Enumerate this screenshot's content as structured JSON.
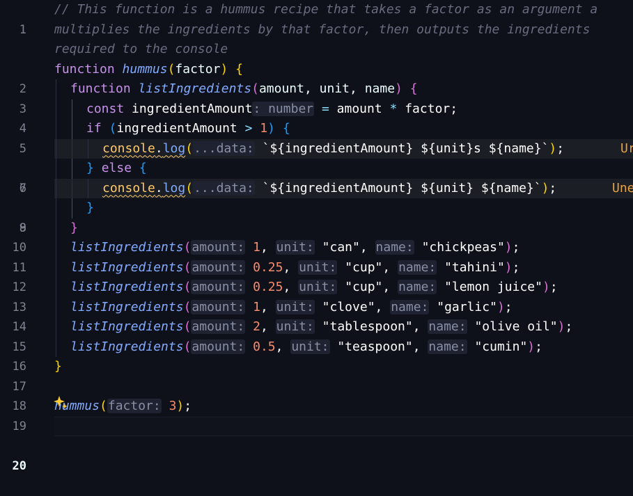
{
  "editor": {
    "line_numbers": [
      "1",
      "",
      "",
      "2",
      "3",
      "4",
      "5",
      "6",
      "7",
      "8",
      "9",
      "10",
      "11",
      "12",
      "13",
      "14",
      "15",
      "16",
      "17",
      "18",
      "19",
      "20"
    ],
    "comment": [
      "// This function is a hummus recipe that takes a factor as an argument a",
      "multiplies the ingredients by that factor, then outputs the ingredients",
      "required to the console"
    ],
    "kw_function": "function",
    "kw_const": "const",
    "kw_if": "if",
    "kw_else": "else",
    "fn_hummus": "hummus",
    "fn_list": "listIngredients",
    "param_factor": "factor",
    "params_list": [
      "amount",
      "unit",
      "name"
    ],
    "var_amount": "ingredientAmount",
    "hint_type": ": number",
    "type_number": "number",
    "console": "console",
    "log": "log",
    "hint_data": "...data:",
    "template_plural": "`${ingredientAmount} ${unit}s ${name}`",
    "template_single": "`${ingredientAmount} ${unit} ${name}`",
    "error_line6": "Ur",
    "error_line8": "Une",
    "hint_amount": "amount:",
    "hint_unit": "unit:",
    "hint_name": "name:",
    "hint_factor": "factor:",
    "calls": [
      {
        "amount": "1",
        "unit": "\"can\"",
        "name": "\"chickpeas\""
      },
      {
        "amount": "0.25",
        "unit": "\"cup\"",
        "name": "\"tahini\""
      },
      {
        "amount": "0.25",
        "unit": "\"cup\"",
        "name": "\"lemon juice\""
      },
      {
        "amount": "1",
        "unit": "\"clove\"",
        "name": "\"garlic\""
      },
      {
        "amount": "2",
        "unit": "\"tablespoon\"",
        "name": "\"olive oil\""
      },
      {
        "amount": "0.5",
        "unit": "\"teaspoon\"",
        "name": "\"cumin\""
      }
    ],
    "main_call_fn": "hummus",
    "main_call_arg": "3"
  },
  "colors": {
    "background": "#0f111a",
    "keyword": "#c792ea",
    "function": "#82aaff",
    "number": "#f78c6c",
    "string": "#c3e88d",
    "comment": "#696b7f",
    "bracket_gold": "#ffd700",
    "bracket_orchid": "#da70d6",
    "bracket_blue": "#179fff"
  }
}
